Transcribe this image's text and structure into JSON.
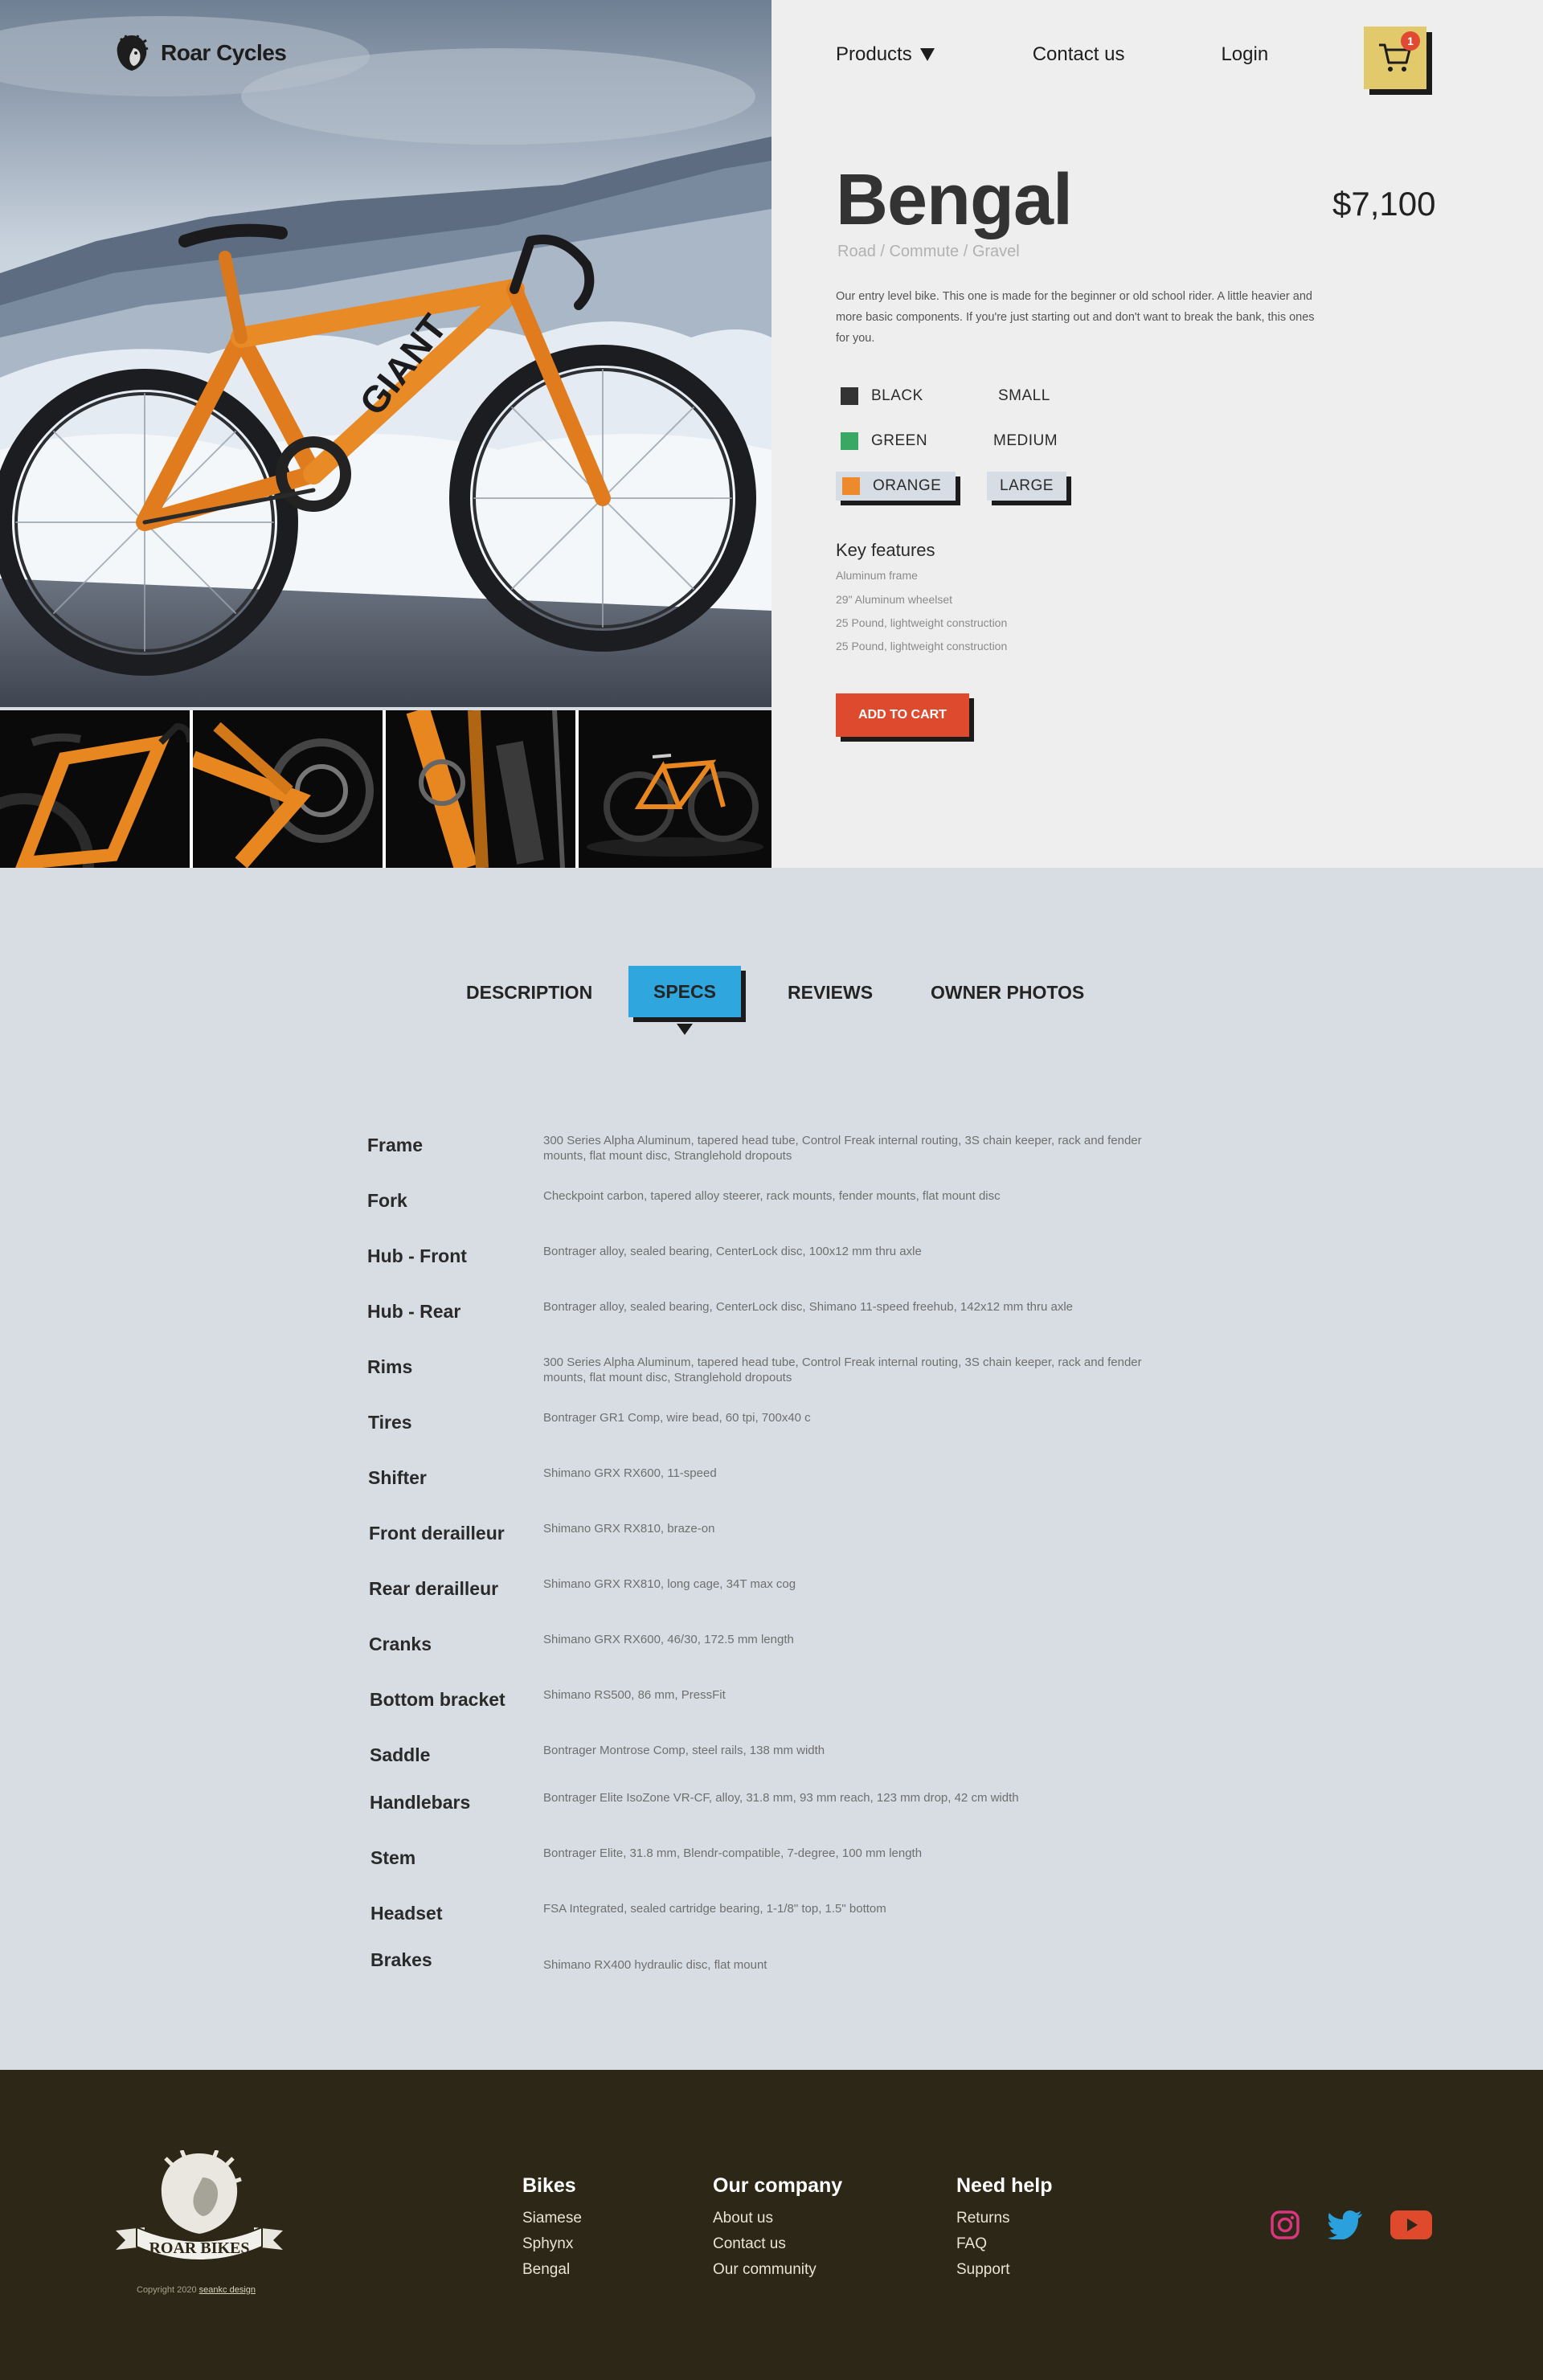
{
  "brand": {
    "name": "Roar Cycles"
  },
  "nav": {
    "products": "Products",
    "contact": "Contact us",
    "login": "Login",
    "cart_count": "1"
  },
  "product": {
    "title": "Bengal",
    "price": "$7,100",
    "categories": "Road / Commute / Gravel",
    "description": "Our entry level bike. This one is made for the beginner or old school rider. A little heavier and more basic components. If you're just starting out and don't want to break the bank, this ones for you.",
    "colors": [
      {
        "label": "BLACK",
        "hex": "#333333"
      },
      {
        "label": "GREEN",
        "hex": "#3aa865"
      },
      {
        "label": "ORANGE",
        "hex": "#ee8a2b",
        "selected": true
      }
    ],
    "sizes": [
      {
        "label": "SMALL"
      },
      {
        "label": "MEDIUM"
      },
      {
        "label": "LARGE",
        "selected": true
      }
    ],
    "key_features_heading": "Key features",
    "key_features": [
      "Aluminum frame",
      "29\" Aluminum wheelset",
      "25 Pound, lightweight construction",
      "25 Pound, lightweight construction"
    ],
    "add_to_cart": "ADD TO CART"
  },
  "tabs": {
    "description": "DESCRIPTION",
    "specs": "SPECS",
    "reviews": "REVIEWS",
    "owner_photos": "OWNER PHOTOS",
    "active": "specs"
  },
  "specs": [
    {
      "label": "Frame",
      "value": "300 Series Alpha Aluminum, tapered head tube, Control Freak internal routing, 3S chain keeper, rack and fender mounts, flat mount disc, Stranglehold dropouts"
    },
    {
      "label": "Fork",
      "value": "Checkpoint carbon, tapered alloy steerer, rack mounts, fender mounts, flat mount disc"
    },
    {
      "label": "Hub - Front",
      "value": "Bontrager alloy, sealed bearing, CenterLock disc, 100x12 mm thru axle"
    },
    {
      "label": "Hub - Rear",
      "value": "Bontrager alloy, sealed bearing, CenterLock disc, Shimano 11-speed freehub, 142x12 mm thru axle"
    },
    {
      "label": "Rims",
      "value": "300 Series Alpha Aluminum, tapered head tube, Control Freak internal routing, 3S chain keeper, rack and fender mounts, flat mount disc, Stranglehold dropouts"
    },
    {
      "label": "Tires",
      "value": "Bontrager GR1 Comp, wire bead, 60 tpi, 700x40 c"
    },
    {
      "label": "Shifter",
      "value": "Shimano GRX RX600, 11-speed"
    },
    {
      "label": "Front derailleur",
      "value": "Shimano GRX RX810, braze-on"
    },
    {
      "label": "Rear derailleur",
      "value": "Shimano GRX RX810, long cage, 34T max cog"
    },
    {
      "label": "Cranks",
      "value": "Shimano GRX RX600, 46/30, 172.5 mm length"
    },
    {
      "label": "Bottom bracket",
      "value": "Shimano RS500, 86 mm, PressFit"
    },
    {
      "label": "Saddle",
      "value": "Bontrager Montrose Comp, steel rails, 138 mm width"
    },
    {
      "label": "Handlebars",
      "value": "Bontrager Elite IsoZone VR-CF, alloy, 31.8 mm, 93 mm reach, 123 mm drop, 42 cm width"
    },
    {
      "label": "Stem",
      "value": "Bontrager Elite, 31.8 mm, Blendr-compatible, 7-degree, 100 mm length"
    },
    {
      "label": "Headset",
      "value": "FSA Integrated, sealed cartridge bearing, 1-1/8\" top, 1.5\" bottom"
    },
    {
      "label": "Brakes",
      "value": "Shimano RX400 hydraulic disc, flat mount"
    }
  ],
  "footer": {
    "logo_text": "ROAR BIKES",
    "copyright": "Copyright 2020",
    "copyright_link": "seankc design",
    "columns": [
      {
        "heading": "Bikes",
        "links": [
          "Siamese",
          "Sphynx",
          "Bengal"
        ]
      },
      {
        "heading": "Our company",
        "links": [
          "About us",
          "Contact us",
          "Our community"
        ]
      },
      {
        "heading": "Need help",
        "links": [
          "Returns",
          "FAQ",
          "Support"
        ]
      }
    ],
    "socials": [
      {
        "icon": "instagram-icon",
        "color": "#d9367f"
      },
      {
        "icon": "twitter-icon",
        "color": "#2aa0dc"
      },
      {
        "icon": "youtube-icon",
        "color": "#df4a2d"
      }
    ]
  },
  "colors": {
    "accent_blue": "#2fa6de",
    "accent_red": "#dd4a2e",
    "cart_yellow": "#e2c96b",
    "footer_bg": "#2c2717",
    "panel_bg": "#efeeef",
    "page_bg": "#d7dde3"
  }
}
